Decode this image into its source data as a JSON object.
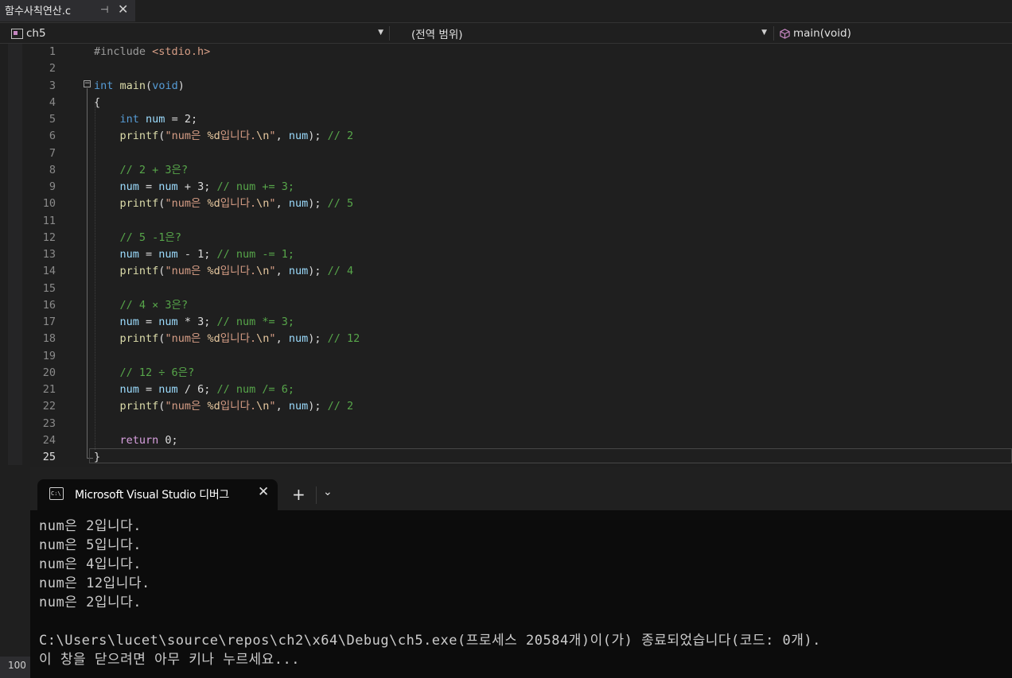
{
  "file_tab": {
    "title": "함수사칙연산.c",
    "pin_icon": "pin-icon",
    "close_icon": "close-icon"
  },
  "navbar": {
    "project": "ch5",
    "scope": "(전역 범위)",
    "function": "main(void)"
  },
  "editor": {
    "current_line": 25,
    "lines": [
      {
        "n": "1"
      },
      {
        "n": "2"
      },
      {
        "n": "3"
      },
      {
        "n": "4"
      },
      {
        "n": "5"
      },
      {
        "n": "6"
      },
      {
        "n": "7"
      },
      {
        "n": "8"
      },
      {
        "n": "9"
      },
      {
        "n": "10"
      },
      {
        "n": "11"
      },
      {
        "n": "12"
      },
      {
        "n": "13"
      },
      {
        "n": "14"
      },
      {
        "n": "15"
      },
      {
        "n": "16"
      },
      {
        "n": "17"
      },
      {
        "n": "18"
      },
      {
        "n": "19"
      },
      {
        "n": "20"
      },
      {
        "n": "21"
      },
      {
        "n": "22"
      },
      {
        "n": "23"
      },
      {
        "n": "24"
      },
      {
        "n": "25"
      }
    ],
    "code": {
      "l1_pp": "#include ",
      "l1_inc": "<stdio.h>",
      "l3_kw": "int",
      "l3_fn": "main",
      "l3_void": "void",
      "brace_open": "{",
      "brace_close": "}",
      "l5_kw": "int",
      "l5_var": "num",
      "l5_rest": " = 2;",
      "printf": "printf",
      "str_num": "\"num은 ",
      "fmt_d": "%d",
      "str_tail": "입니다.",
      "esc_n": "\\n",
      "quote": "\"",
      "var_num": "num",
      "l6_cmt": "// 2",
      "l8_cmt": "// 2 + 3은?",
      "l9_op": " + 3; ",
      "l9_cmt": "// num += 3;",
      "l10_cmt": "// 5",
      "l12_cmt": "// 5 -1은?",
      "l13_op": " - 1; ",
      "l13_cmt": "// num -= 1;",
      "l14_cmt": "// 4",
      "l16_cmt": "// 4 × 3은?",
      "l17_op": " * 3; ",
      "l17_cmt": "// num *= 3;",
      "l18_cmt": "// 12",
      "l20_cmt": "// 12 ÷ 6은?",
      "l21_op": " / 6; ",
      "l21_cmt": "// num /= 6;",
      "l22_cmt": "// 2",
      "l24_kw": "return",
      "l24_rest": " 0;"
    }
  },
  "console": {
    "tab_title": "Microsoft Visual Studio 디버그",
    "icon_text": "C:\\",
    "output": [
      "num은 2입니다.",
      "num은 5입니다.",
      "num은 4입니다.",
      "num은 12입니다.",
      "num은 2입니다.",
      "",
      "C:\\Users\\lucet\\source\\repos\\ch2\\x64\\Debug\\ch5.exe(프로세스 20584개)이(가) 종료되었습니다(코드: 0개).",
      "이 창을 닫으려면 아무 키나 누르세요..."
    ]
  },
  "zoom": "100",
  "colors": {
    "keyword": "#569cd6",
    "comment": "#57a64a",
    "string": "#d69d85",
    "function": "#dcdcaa",
    "variable": "#9cdcfe"
  }
}
